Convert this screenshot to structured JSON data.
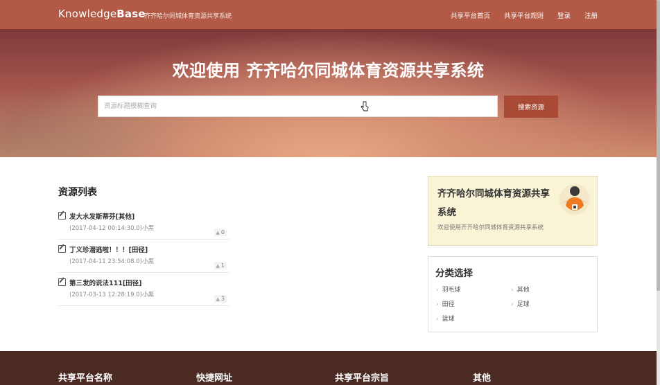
{
  "header": {
    "brand_main": "Knowledge",
    "brand_bold": "Base",
    "brand_sub": "齐齐哈尔同城体育资源共享系统",
    "nav": [
      "共享平台首页",
      "共享平台规则",
      "登录",
      "注册"
    ]
  },
  "hero": {
    "title": "欢迎使用 齐齐哈尔同城体育资源共享系统",
    "search_placeholder": "资源标题模糊查询",
    "search_button": "搜索资源"
  },
  "resources": {
    "title": "资源列表",
    "items": [
      {
        "title": "发大水发斯蒂芬[其他]",
        "meta": "(2017-04-12 00:14:30.0)小黑",
        "likes": "0"
      },
      {
        "title": "丁义珍潜逃啦！！！[田径]",
        "meta": "(2017-04-11 23:54:08.0)小黑",
        "likes": "1"
      },
      {
        "title": "第三发的说法111[田径]",
        "meta": "(2017-03-13 12:28:19.0)小黑",
        "likes": "3"
      }
    ]
  },
  "info": {
    "title": "齐齐哈尔同城体育资源共享系统",
    "subtitle": "欢迎使用齐齐哈尔同城体育资源共享系统"
  },
  "categories": {
    "title": "分类选择",
    "items": [
      "羽毛球",
      "其他",
      "田径",
      "足球",
      "篮球"
    ]
  },
  "footer": {
    "headings": [
      "共享平台名称",
      "快捷网址",
      "共享平台宗旨",
      "其他"
    ]
  },
  "colors": {
    "header": "#b25a45",
    "accent": "#a84a35",
    "footer": "#4a2a22",
    "info_bg": "#faf4d6"
  }
}
